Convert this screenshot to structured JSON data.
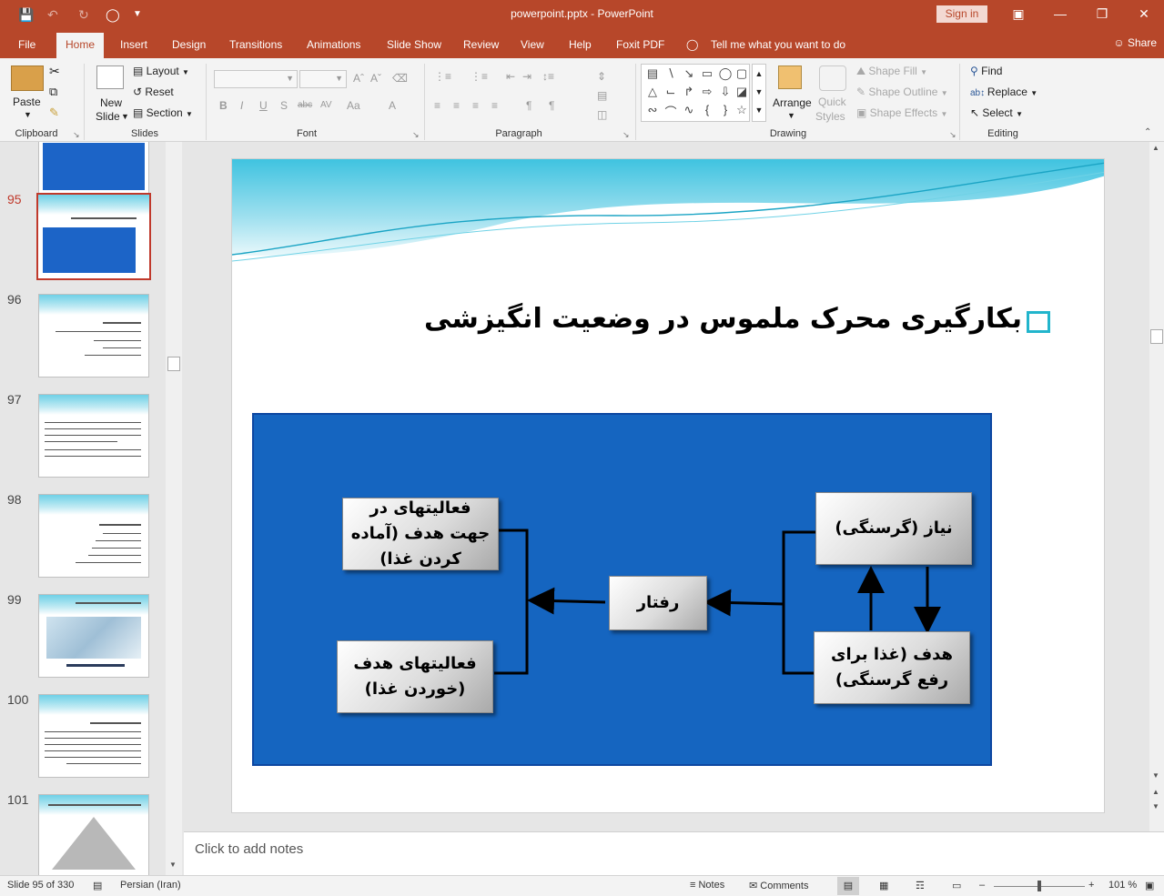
{
  "app": {
    "doc_title": "powerpoint.pptx  -  PowerPoint",
    "signin_label": "Sign in",
    "share_label": "Share"
  },
  "tabs": [
    {
      "label": "File"
    },
    {
      "label": "Home"
    },
    {
      "label": "Insert"
    },
    {
      "label": "Design"
    },
    {
      "label": "Transitions"
    },
    {
      "label": "Animations"
    },
    {
      "label": "Slide Show"
    },
    {
      "label": "Review"
    },
    {
      "label": "View"
    },
    {
      "label": "Help"
    },
    {
      "label": "Foxit PDF"
    },
    {
      "label": "Tell me what you want to do"
    }
  ],
  "ribbon": {
    "clipboard": {
      "paste": "Paste",
      "group": "Clipboard"
    },
    "slides": {
      "new_slide_1": "New",
      "new_slide_2": "Slide",
      "layout": "Layout",
      "reset": "Reset",
      "section": "Section",
      "group": "Slides"
    },
    "font": {
      "group": "Font",
      "bold": "B",
      "italic": "I",
      "underline": "U",
      "shadow": "S",
      "strike": "abc",
      "spacing": "AV",
      "case": "Aa",
      "color": "A"
    },
    "paragraph": {
      "group": "Paragraph"
    },
    "drawing": {
      "arrange": "Arrange",
      "quick_styles_1": "Quick",
      "quick_styles_2": "Styles",
      "shape_fill": "Shape Fill",
      "shape_outline": "Shape Outline",
      "shape_effects": "Shape Effects",
      "group": "Drawing"
    },
    "editing": {
      "find": "Find",
      "replace": "Replace",
      "select": "Select",
      "group": "Editing"
    }
  },
  "thumbnails": [
    {
      "num": "95"
    },
    {
      "num": "96"
    },
    {
      "num": "97"
    },
    {
      "num": "98"
    },
    {
      "num": "99"
    },
    {
      "num": "100"
    },
    {
      "num": "101"
    }
  ],
  "slide": {
    "title": "بکارگیری محرک ملموس در وضعیت انگیزشی",
    "boxes": {
      "need": "نیاز (گرسنگی)",
      "goal": "هدف (غذا برای رفع گرسنگی)",
      "behavior": "رفتار",
      "activities_toward": "فعالیتهای در جهت هدف (آماده کردن غذا)",
      "goal_activities": "فعالیتهای هدف (خوردن غذا)"
    }
  },
  "notes_placeholder": "Click to add notes",
  "status": {
    "slide_of": "Slide 95 of 330",
    "language": "Persian (Iran)",
    "notes": "Notes",
    "comments": "Comments",
    "zoom": "101 %"
  },
  "colors": {
    "accent": "#b7472a",
    "diagram_bg": "#1565c0",
    "bullet": "#22b5cc"
  }
}
